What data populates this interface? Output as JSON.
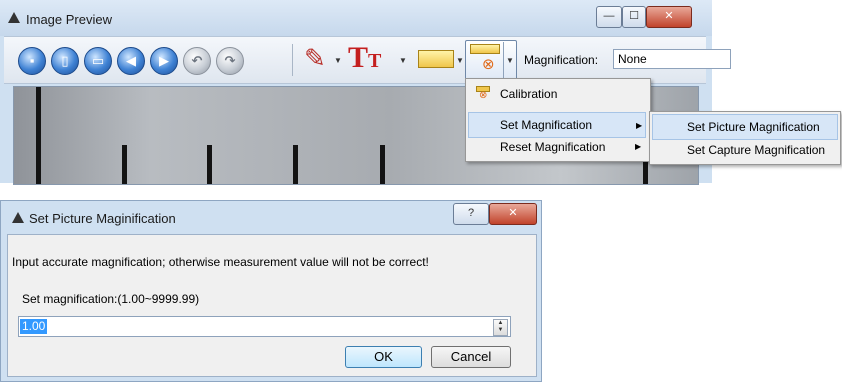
{
  "preview_window": {
    "title": "Image Preview",
    "caption_buttons": {
      "minimize": "—",
      "maximize": "☐",
      "close": "✕"
    }
  },
  "toolbar": {
    "buttons": [
      {
        "name": "save-button",
        "icon": "floppy-icon",
        "style": "blue"
      },
      {
        "name": "open-button",
        "icon": "document-icon",
        "style": "blue"
      },
      {
        "name": "copy-button",
        "icon": "copy-icon",
        "style": "blue"
      },
      {
        "name": "previous-button",
        "icon": "arrow-left-icon",
        "style": "blue"
      },
      {
        "name": "next-button",
        "icon": "arrow-right-icon",
        "style": "blue"
      },
      {
        "name": "undo-button",
        "icon": "undo-icon",
        "style": "gray"
      },
      {
        "name": "redo-button",
        "icon": "redo-icon",
        "style": "gray"
      }
    ],
    "magnification_label": "Magnification:",
    "magnification_value": "None"
  },
  "magnification_menu": {
    "items": [
      {
        "label": "Calibration",
        "icon": "calibration-icon",
        "has_submenu": false
      },
      {
        "label": "Set Magnification",
        "has_submenu": true,
        "highlighted": true
      },
      {
        "label": "Reset Magnification",
        "has_submenu": true
      }
    ],
    "submenu": [
      {
        "label": "Set Picture Magnification",
        "highlighted": true
      },
      {
        "label": "Set Capture Magnification"
      }
    ]
  },
  "dialog": {
    "title": "Set Picture Maginification",
    "caption_buttons": {
      "help": "?",
      "close": "✕"
    },
    "warning": "Input accurate magnification; otherwise measurement value will not be correct!",
    "range_label": "Set magnification:(1.00~9999.99)",
    "value": "1.00",
    "ok_label": "OK",
    "cancel_label": "Cancel"
  },
  "colors": {
    "window_frame": "#cfe0f1",
    "selection": "#3399ff",
    "menu_highlight": "#d7e6f7",
    "close_button": "#c1432b"
  }
}
